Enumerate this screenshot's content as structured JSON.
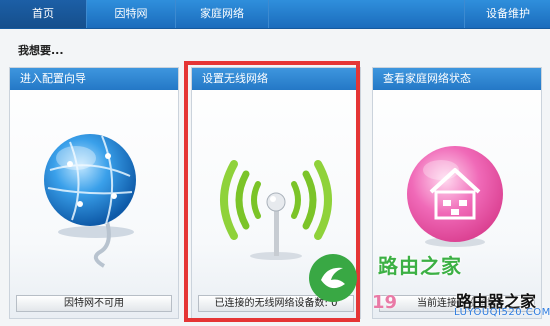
{
  "nav": {
    "home": "首页",
    "internet": "因特网",
    "home_network": "家庭网络",
    "device_maintenance": "设备维护"
  },
  "heading": "我想要...",
  "cards": [
    {
      "title": "进入配置向导",
      "status": "因特网不可用",
      "icon": "globe-icon"
    },
    {
      "title": "设置无线网络",
      "status": "已连接的无线网络设备数: 0",
      "icon": "wireless-signal-icon"
    },
    {
      "title": "查看家庭网络状态",
      "status": "当前连接的设备数",
      "icon": "home-network-icon"
    }
  ],
  "watermark": {
    "site_name": "路由之家",
    "number": "19",
    "brand": "路由器之家",
    "url": "LUYOUQI520.COM"
  },
  "colors": {
    "nav_blue": "#1b6cbc",
    "highlight_red": "#e53535",
    "signal_green": "#7bc428"
  }
}
